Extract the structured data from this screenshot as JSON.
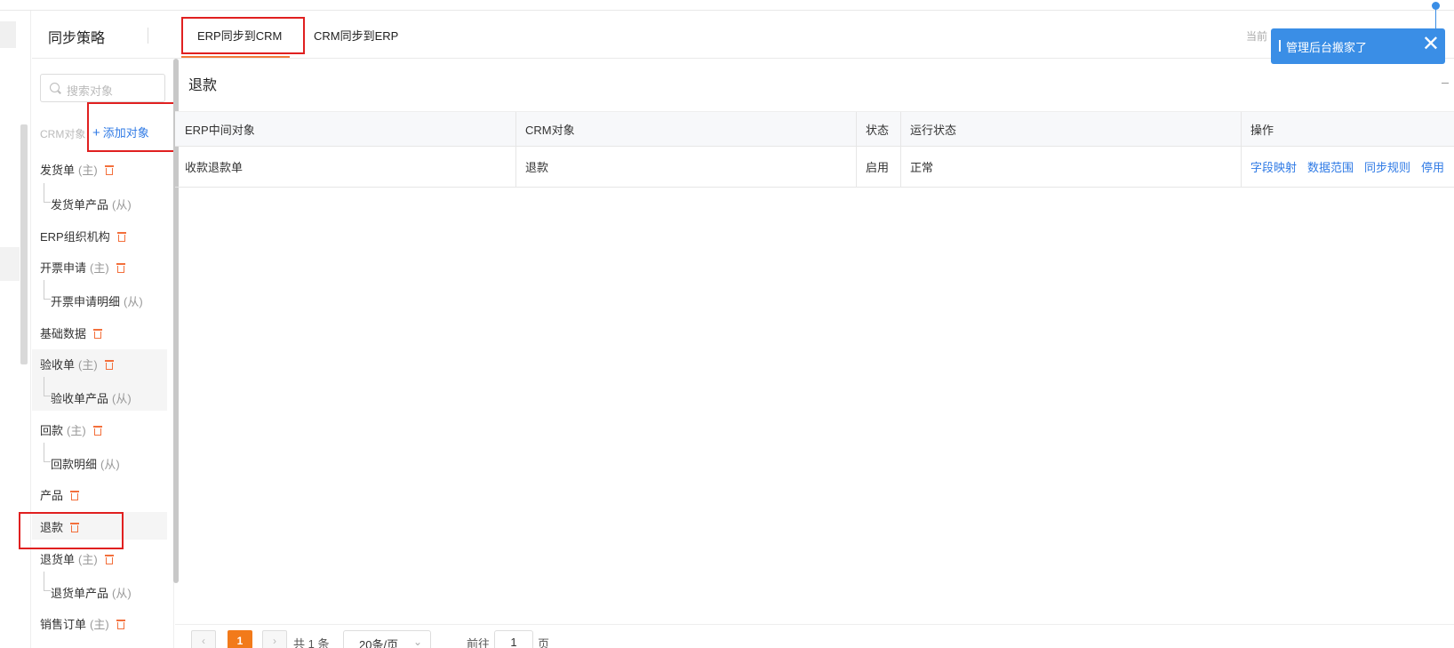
{
  "header": {
    "title": "同步策略",
    "tabs": [
      {
        "label": "ERP同步到CRM",
        "active": true
      },
      {
        "label": "CRM同步到ERP",
        "active": false
      }
    ],
    "current_prefix": "当前"
  },
  "toast": {
    "message": "管理后台搬家了",
    "close": "✕"
  },
  "panel": {
    "search_placeholder": "搜索对象",
    "crm_label": "CRM对象",
    "add_label": "添加对象",
    "add_plus": "+",
    "items": [
      {
        "label": "发货单",
        "suffix": "(主)",
        "deletable": true
      },
      {
        "label": "发货单产品",
        "suffix": "(从)",
        "child": true
      },
      {
        "label": "ERP组织机构",
        "deletable": true
      },
      {
        "label": "开票申请",
        "suffix": "(主)",
        "deletable": true
      },
      {
        "label": "开票申请明细",
        "suffix": "(从)",
        "child": true
      },
      {
        "label": "基础数据",
        "deletable": true
      },
      {
        "label": "验收单",
        "suffix": "(主)",
        "deletable": true
      },
      {
        "label": "验收单产品",
        "suffix": "(从)",
        "child": true
      },
      {
        "label": "回款",
        "suffix": "(主)",
        "deletable": true
      },
      {
        "label": "回款明细",
        "suffix": "(从)",
        "child": true
      },
      {
        "label": "产品",
        "deletable": true
      },
      {
        "label": "退款",
        "deletable": true,
        "selected": true
      },
      {
        "label": "退货单",
        "suffix": "(主)",
        "deletable": true
      },
      {
        "label": "退货单产品",
        "suffix": "(从)",
        "child": true
      },
      {
        "label": "销售订单",
        "suffix": "(主)",
        "deletable": true
      }
    ]
  },
  "main": {
    "title": "退款",
    "table": {
      "columns": [
        "ERP中间对象",
        "CRM对象",
        "状态",
        "运行状态",
        "操作"
      ],
      "rows": [
        {
          "erp_object": "收款退款单",
          "crm_object": "退款",
          "status": "启用",
          "run_status": "正常",
          "actions": [
            "字段映射",
            "数据范围",
            "同步规则",
            "停用"
          ]
        }
      ]
    }
  },
  "pagination": {
    "prev": "‹",
    "next": "›",
    "current_page": "1",
    "total": "共 1 条",
    "page_size": "20条/页",
    "goto_prefix": "前往",
    "goto_value": "1",
    "goto_suffix": "页"
  },
  "colors": {
    "accent_orange": "#f27a1a",
    "link_blue": "#2f7ae5",
    "toast_blue": "#3a8ee6",
    "trash": "#f36f3b",
    "highlight_red": "#e02020"
  }
}
